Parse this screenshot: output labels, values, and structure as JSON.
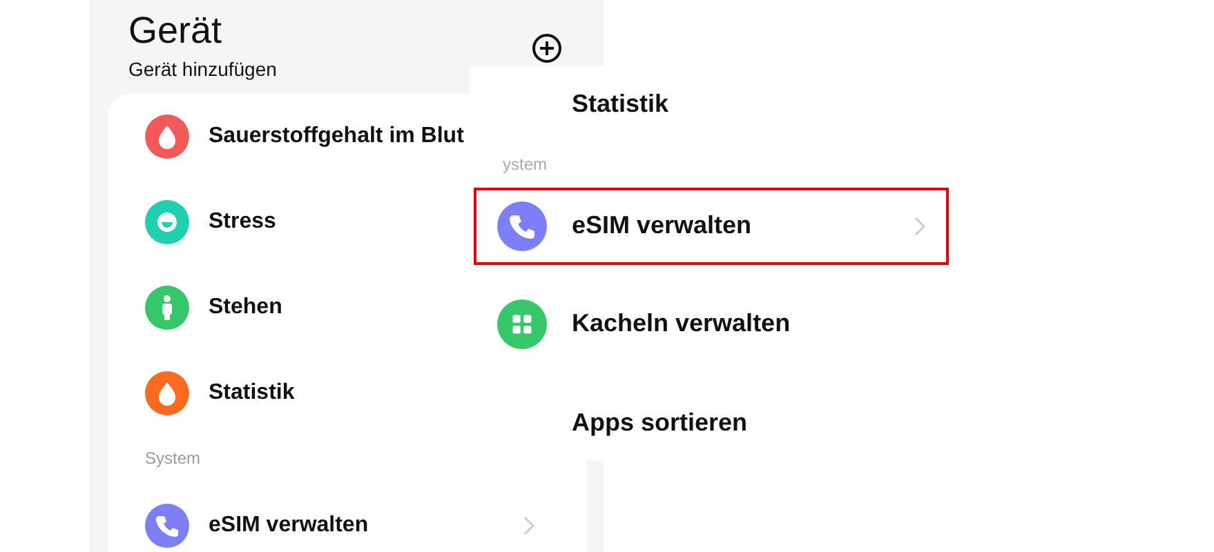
{
  "header": {
    "title": "Gerät",
    "subtitle": "Gerät hinzufügen"
  },
  "list": [
    {
      "kind": "item",
      "label": "Sauerstoffgehalt im Blut",
      "color": "#f25a5a"
    },
    {
      "kind": "item",
      "label": "Stress",
      "color": "#1fcfb0"
    },
    {
      "kind": "item",
      "label": "Stehen",
      "color": "#35c76a"
    },
    {
      "kind": "item",
      "label": "Statistik",
      "color": "#fb6a1e"
    },
    {
      "kind": "section",
      "label": "System"
    },
    {
      "kind": "link",
      "label": "eSIM verwalten",
      "color": "#7c7ff5"
    }
  ],
  "zoom": [
    {
      "kind": "item",
      "label": "Statistik",
      "highlighted": false
    },
    {
      "kind": "section",
      "label": "ystem"
    },
    {
      "kind": "link",
      "label": "eSIM verwalten",
      "color": "#7c7ff5",
      "highlighted": true
    },
    {
      "kind": "item",
      "label": "Kacheln verwalten",
      "color": "#35c76a",
      "highlighted": false
    },
    {
      "kind": "item",
      "label": "Apps sortieren",
      "highlighted": false
    }
  ]
}
